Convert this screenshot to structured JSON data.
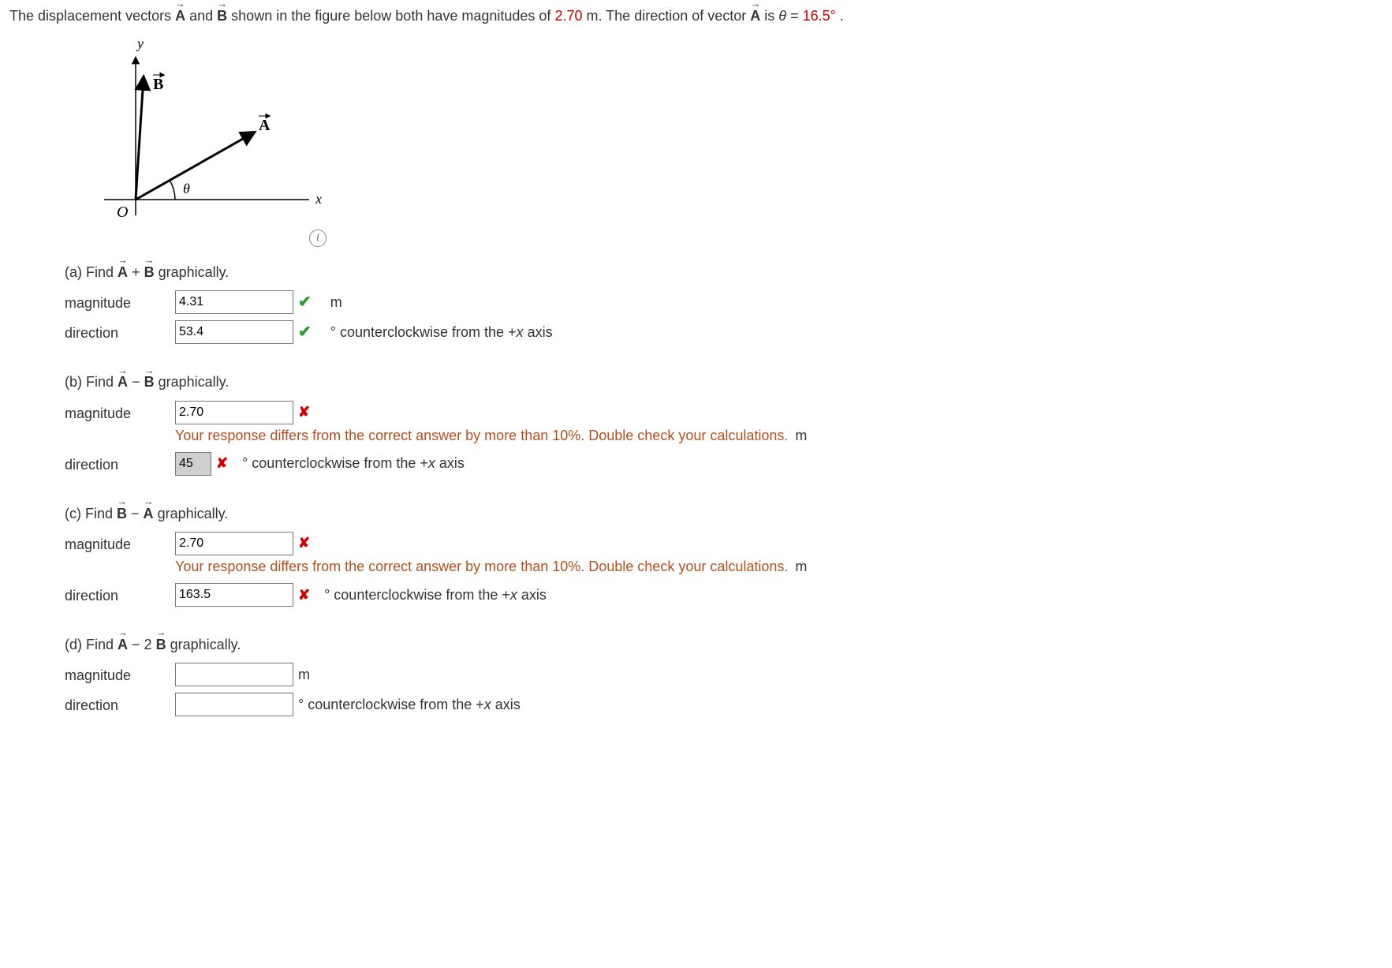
{
  "prompt": {
    "pre1": "The displacement vectors ",
    "vecA": "A",
    "mid1": " and ",
    "vecB": "B",
    "mid2": " shown in the figure below both have magnitudes of ",
    "mag": "2.70",
    "mid3": " m. The direction of vector ",
    "vecA2": "A",
    "mid4": " is ",
    "theta": "θ",
    "eq": " = ",
    "angle": "16.5°",
    "end": "."
  },
  "figure": {
    "y": "y",
    "x": "x",
    "O": "O",
    "A": "A",
    "B": "B",
    "theta": "θ"
  },
  "info_icon_glyph": "i",
  "labels": {
    "magnitude": "magnitude",
    "direction": "direction",
    "unit_m": "m",
    "deg_ccw": "° counterclockwise from the +",
    "x_axis_var": "x",
    "axis_word": " axis"
  },
  "parts": {
    "a": {
      "title_pre": "(a) Find ",
      "vec1": "A",
      "op": " + ",
      "vec2": "B",
      "title_post": " graphically.",
      "magnitude_value": "4.31",
      "direction_value": "53.4"
    },
    "b": {
      "title_pre": "(b) Find ",
      "vec1": "A",
      "op": " − ",
      "vec2": "B",
      "title_post": " graphically.",
      "magnitude_value": "2.70",
      "direction_value": "45",
      "feedback": "Your response differs from the correct answer by more than 10%. Double check your calculations."
    },
    "c": {
      "title_pre": "(c) Find ",
      "vec1": "B",
      "op": " − ",
      "vec2": "A",
      "title_post": " graphically.",
      "magnitude_value": "2.70",
      "direction_value": "163.5",
      "feedback": "Your response differs from the correct answer by more than 10%. Double check your calculations."
    },
    "d": {
      "title_pre": "(d) Find ",
      "vec1": "A",
      "op": " − 2",
      "vec2": "B",
      "title_post": " graphically.",
      "magnitude_value": "",
      "direction_value": ""
    }
  }
}
